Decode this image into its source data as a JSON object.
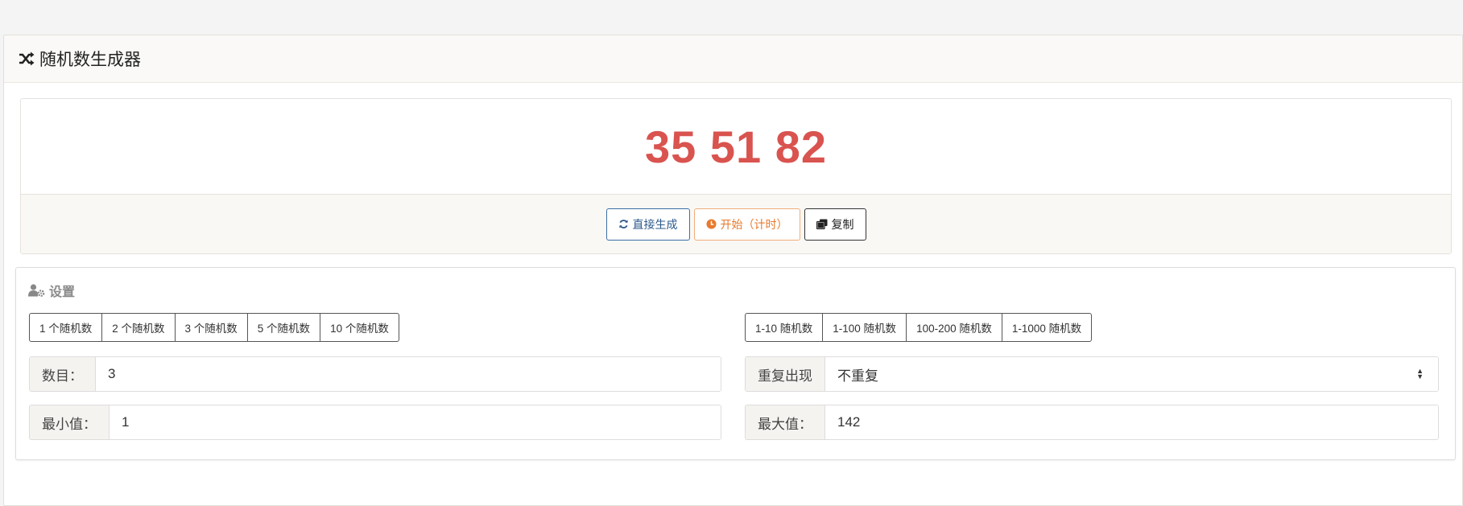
{
  "header": {
    "title": "随机数生成器",
    "icon": "shuffle-icon"
  },
  "result": {
    "value": "35 51 82",
    "color": "#d9534f"
  },
  "actions": {
    "generate_label": "直接生成",
    "start_label": "开始（计时）",
    "copy_label": "复制"
  },
  "settings": {
    "title": "设置",
    "count_presets": [
      "1 个随机数",
      "2 个随机数",
      "3 个随机数",
      "5 个随机数",
      "10 个随机数"
    ],
    "range_presets": [
      "1-10 随机数",
      "1-100 随机数",
      "100-200 随机数",
      "1-1000 随机数"
    ],
    "count": {
      "label": "数目：",
      "value": "3"
    },
    "repeat": {
      "label": "重复出现",
      "value": "不重复"
    },
    "min": {
      "label": "最小值：",
      "value": "1"
    },
    "max": {
      "label": "最大值：",
      "value": "142"
    }
  }
}
